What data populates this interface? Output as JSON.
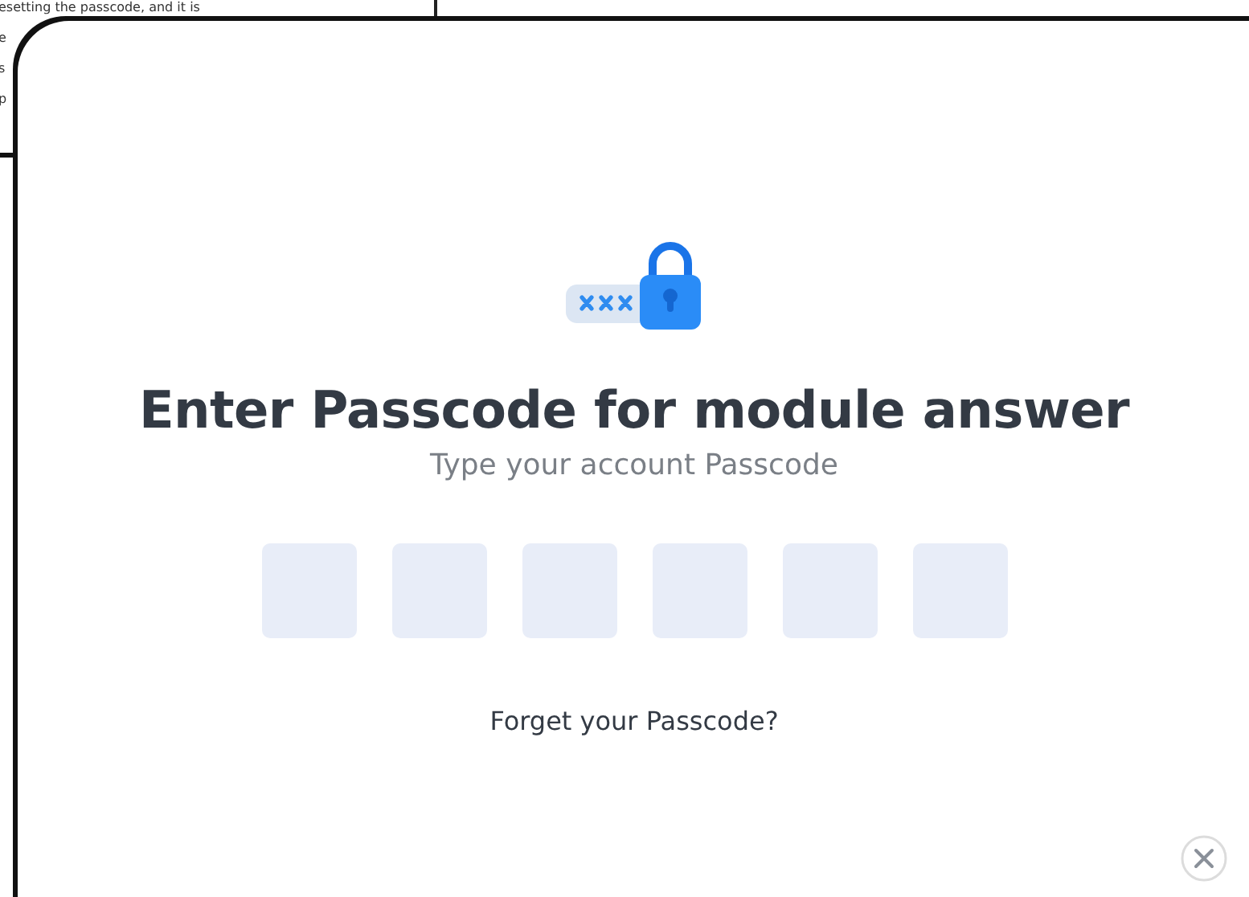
{
  "background_page": {
    "lines": [
      "esetting the passcode, and it is",
      "e",
      "s",
      "p"
    ]
  },
  "dialog": {
    "title": "Enter Passcode for module answer",
    "subtitle": "Type your account Passcode",
    "passcode_digits": [
      {
        "filled": false
      },
      {
        "filled": false
      },
      {
        "filled": false
      },
      {
        "filled": false
      },
      {
        "filled": false
      },
      {
        "filled": false
      }
    ],
    "forgot_link": "Forget your Passcode?"
  }
}
